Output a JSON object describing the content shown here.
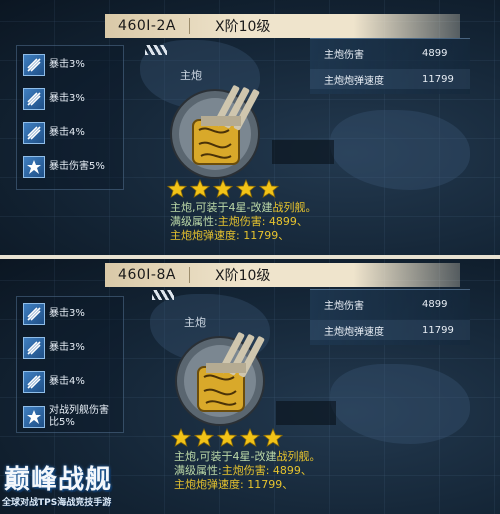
{
  "panels": [
    {
      "code": "460Ⅰ-2A",
      "grade": "X阶10级",
      "gun_label": "主炮",
      "skills": [
        {
          "icon": "crit-icon",
          "label": "暴击3%"
        },
        {
          "icon": "crit-icon",
          "label": "暴击3%"
        },
        {
          "icon": "crit-icon",
          "label": "暴击4%"
        },
        {
          "icon": "crit-damage-icon",
          "label": "暴击伤害5%"
        }
      ],
      "stats": [
        {
          "label": "主炮伤害",
          "value": "4899"
        },
        {
          "label": "主炮炮弹速度",
          "value": "11799"
        }
      ],
      "stars": 5,
      "desc": {
        "line1_a": "主炮,可装于4星-改建",
        "line1_b": "战列舰。",
        "line2_a": "满级属性:",
        "line2_b": "主炮伤害: 4899、",
        "line3": "主炮炮弹速度: 11799、"
      }
    },
    {
      "code": "460Ⅰ-8A",
      "grade": "X阶10级",
      "gun_label": "主炮",
      "skills": [
        {
          "icon": "crit-icon",
          "label": "暴击3%"
        },
        {
          "icon": "crit-icon",
          "label": "暴击3%"
        },
        {
          "icon": "crit-icon",
          "label": "暴击4%"
        },
        {
          "icon": "crit-damage-icon",
          "label_l1": "对战列舰伤害",
          "label_l2": "比5%"
        }
      ],
      "stats": [
        {
          "label": "主炮伤害",
          "value": "4899"
        },
        {
          "label": "主炮炮弹速度",
          "value": "11799"
        }
      ],
      "stars": 5,
      "desc": {
        "line1_a": "主炮,可装于4星-改建",
        "line1_b": "战列舰。",
        "line2_a": "满级属性:",
        "line2_b": "主炮伤害: 4899、",
        "line3": "主炮炮弹速度: 11799、"
      }
    }
  ],
  "logo": {
    "title": "巅峰战舰",
    "subtitle": "全球对战TPS海战竞技手游"
  },
  "colors": {
    "accent_yellow": "#e6c32e",
    "accent_green": "#bcd9a8",
    "star_gold": "#f2c318"
  }
}
